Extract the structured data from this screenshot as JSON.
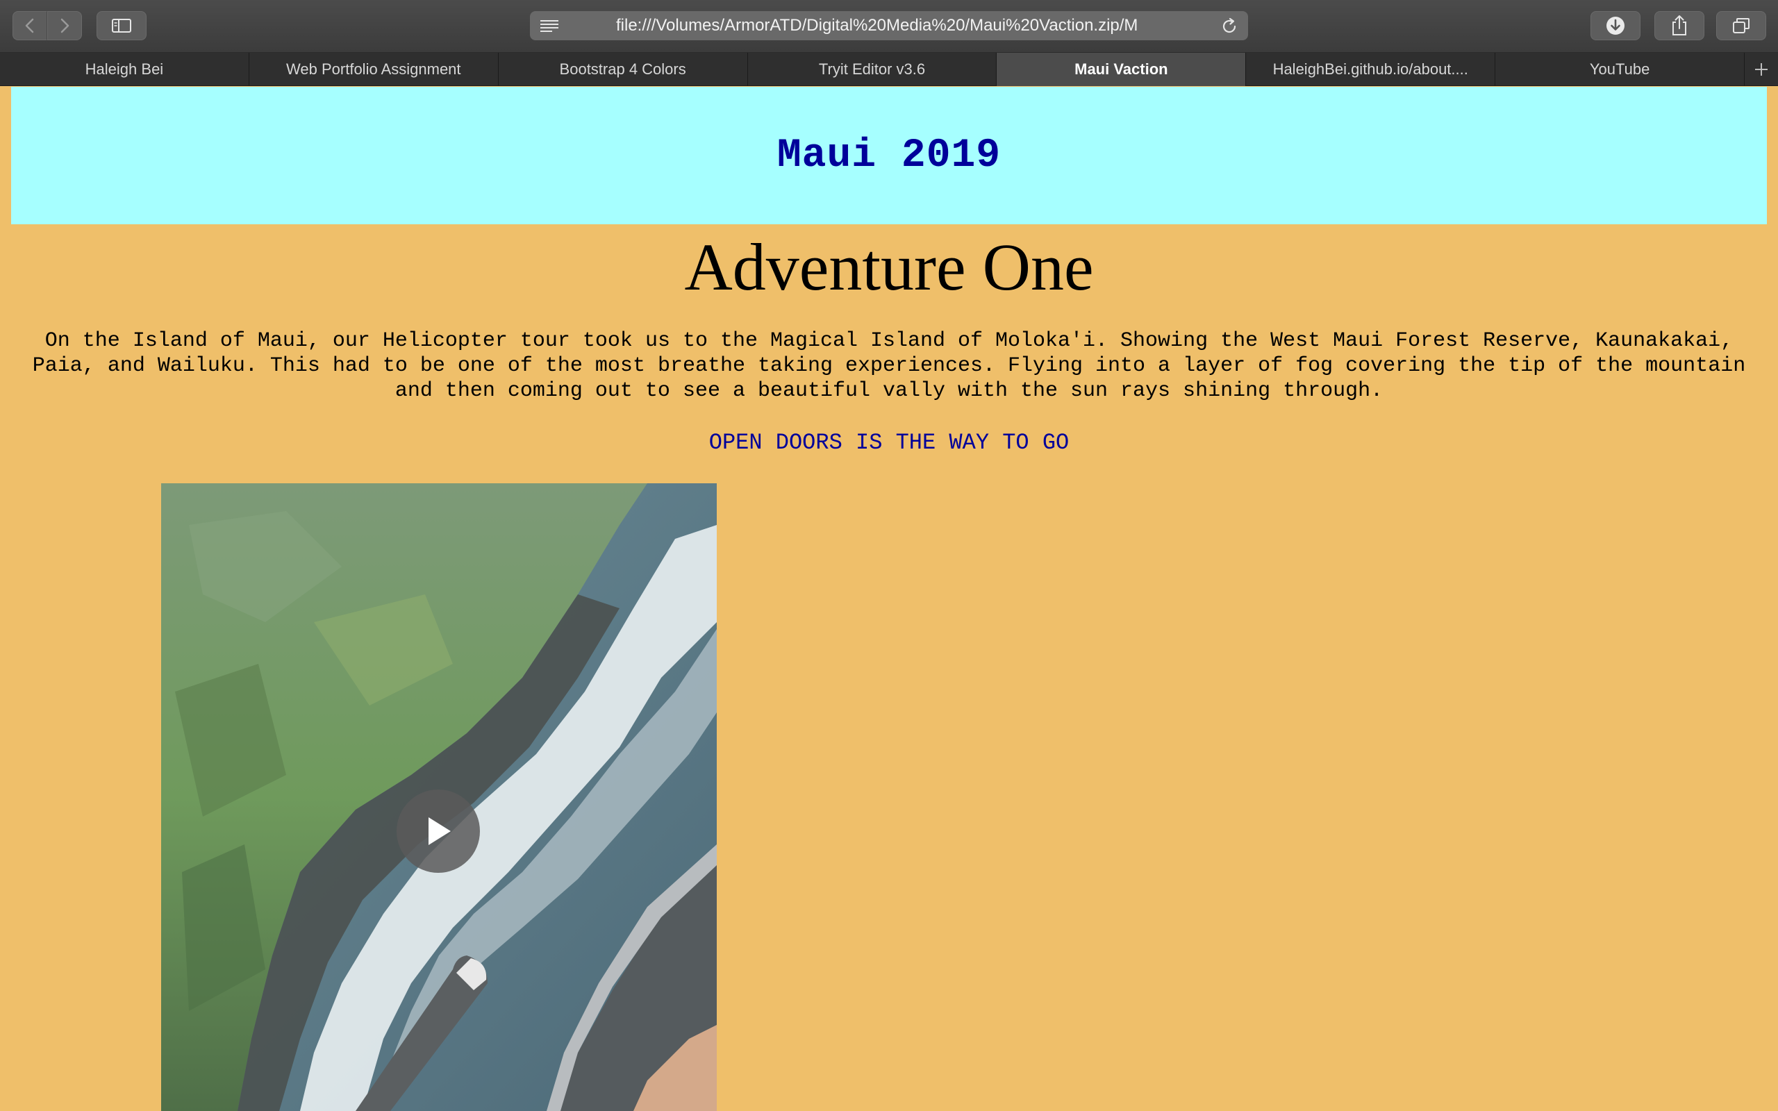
{
  "browser": {
    "url": "file:///Volumes/ArmorATD/Digital%20Media%20/Maui%20Vaction.zip/M",
    "tabs": [
      {
        "label": "Haleigh Bei",
        "active": false
      },
      {
        "label": "Web Portfolio Assignment",
        "active": false
      },
      {
        "label": "Bootstrap 4 Colors",
        "active": false
      },
      {
        "label": "Tryit Editor v3.6",
        "active": false
      },
      {
        "label": "Maui Vaction",
        "active": true
      },
      {
        "label": "HaleighBei.github.io/about....",
        "active": false
      },
      {
        "label": "YouTube",
        "active": false
      }
    ],
    "icons": [
      "back-icon",
      "forward-icon",
      "sidebar-icon",
      "reader-icon",
      "reload-icon",
      "download-icon",
      "share-icon",
      "tabs-overview-icon",
      "new-tab-icon"
    ]
  },
  "page": {
    "header_title": "Maui 2019",
    "adventure_title": "Adventure One",
    "story": "On the Island of Maui, our Helicopter tour took us to the Magical Island of Moloka'i. Showing the West Maui Forest Reserve, Kaunakakai, Paia, and Wailuku. This had to be one of the most breathe taking experiences. Flying into a layer of fog covering the tip of the mountain and then coming out to see a beautiful vally with the sun rays shining through.",
    "tagline": "OPEN DOORS IS THE WAY TO GO"
  },
  "colors": {
    "page_background": "#efbf6a",
    "header_background": "#a6ffff",
    "header_text": "#00009a",
    "tagline_text": "#00009a"
  }
}
